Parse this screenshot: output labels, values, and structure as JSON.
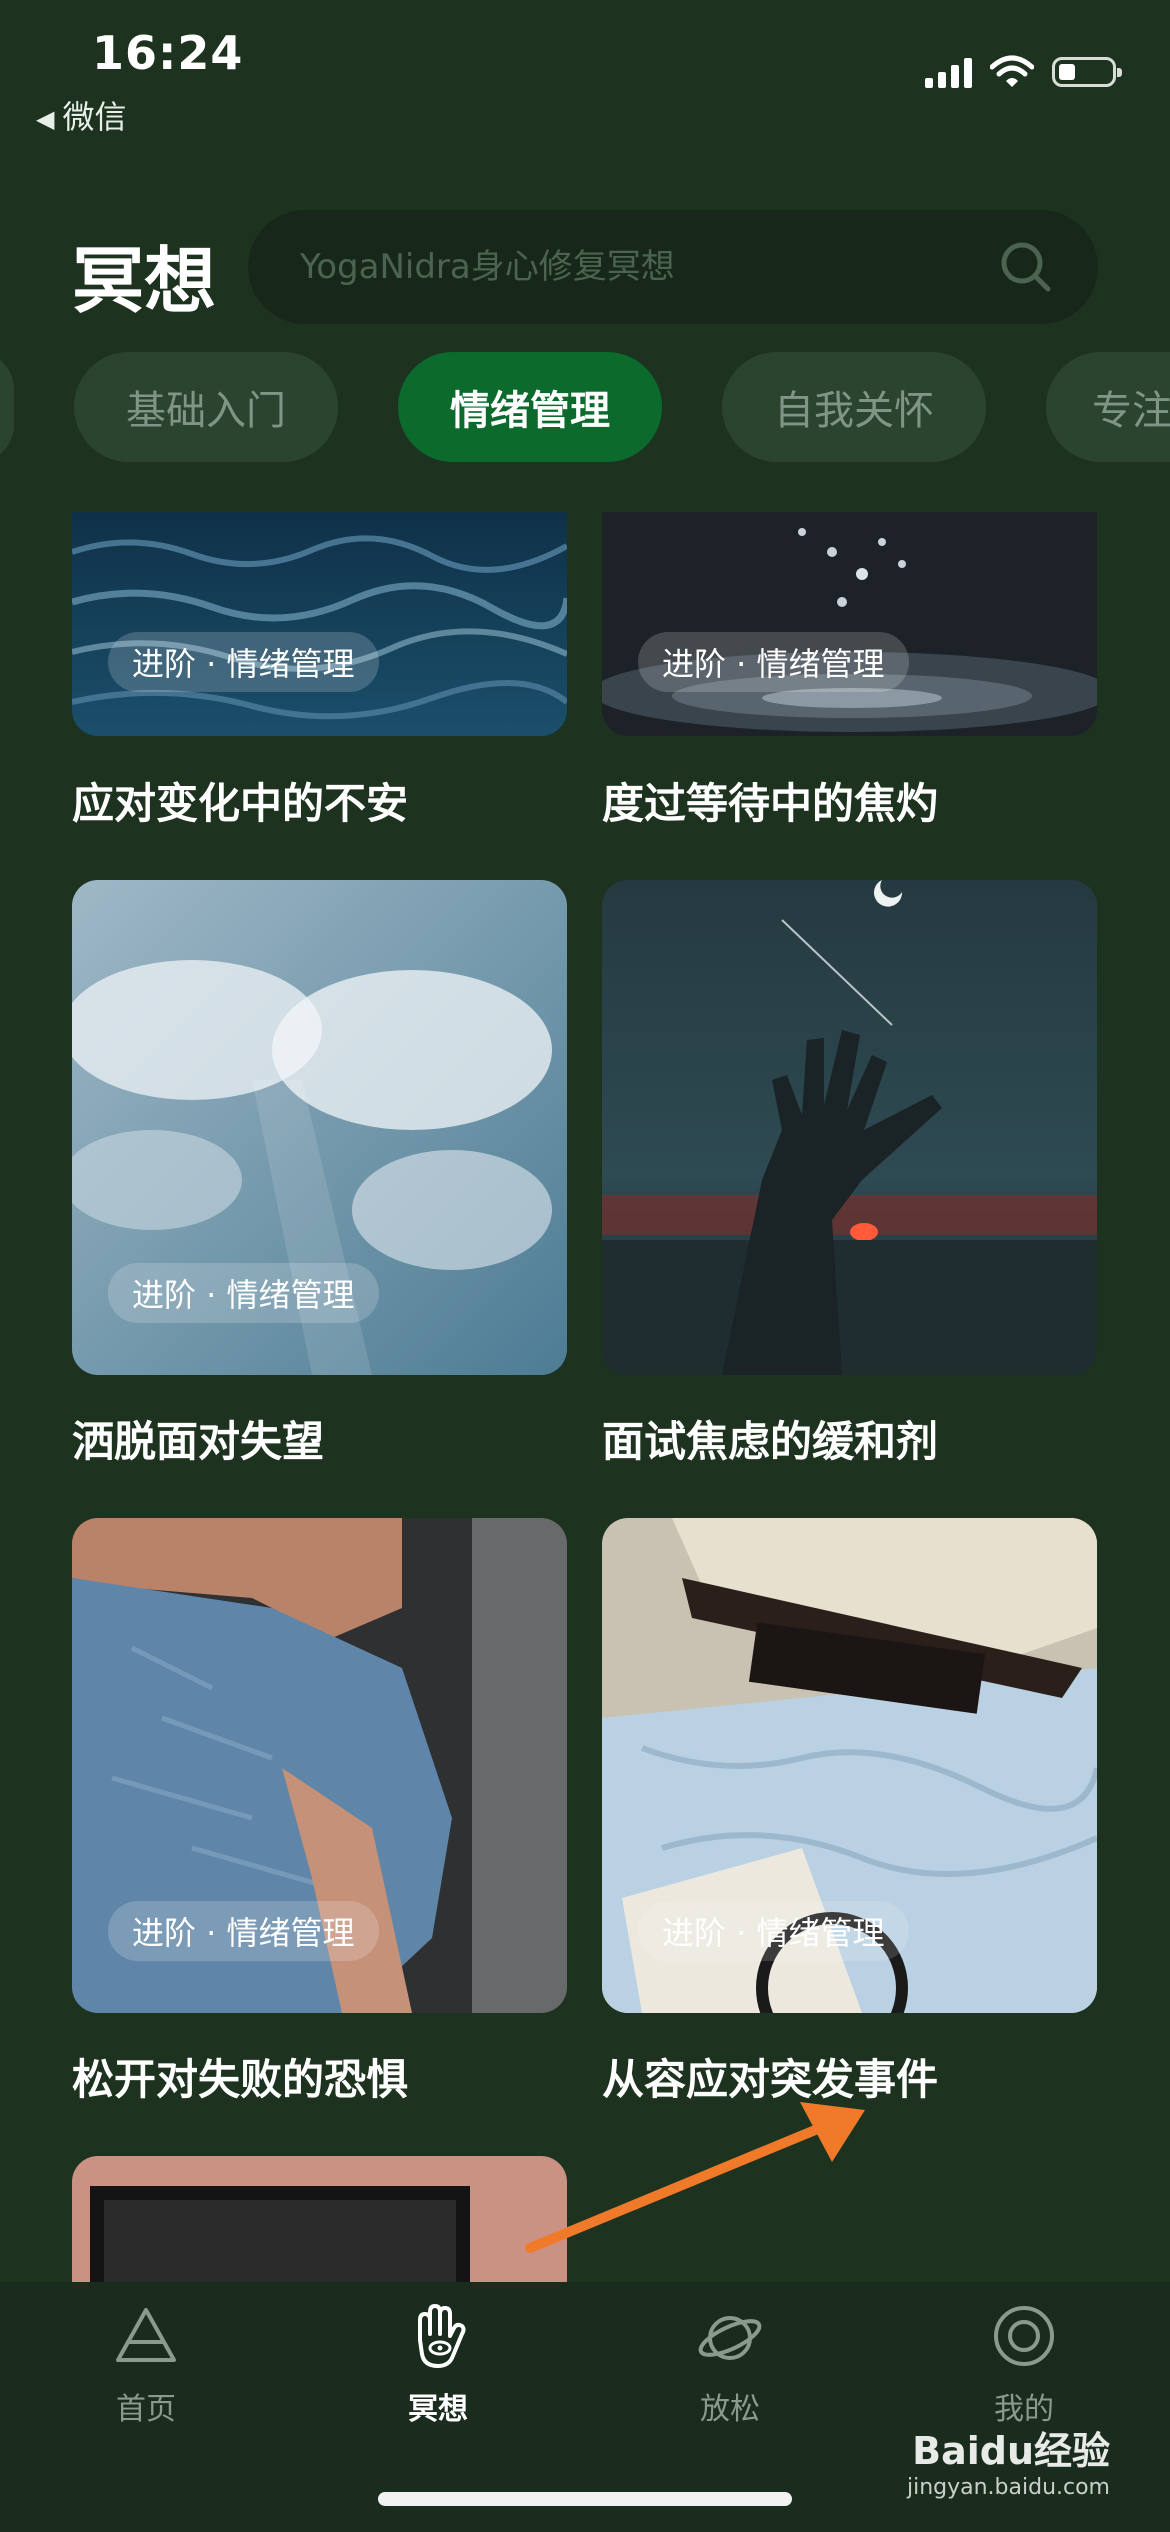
{
  "status_bar": {
    "time": "16:24",
    "back_label": "微信"
  },
  "header": {
    "title": "冥想",
    "search_placeholder": "YogaNidra身心修复冥想"
  },
  "tabs": [
    {
      "label": "基础入门",
      "active": false
    },
    {
      "label": "情绪管理",
      "active": true
    },
    {
      "label": "自我关怀",
      "active": false
    },
    {
      "label": "专注",
      "active": false
    }
  ],
  "cards": [
    {
      "badge": "进阶 · 情绪管理",
      "title": "应对变化中的不安",
      "image": "ocean-waves"
    },
    {
      "badge": "进阶 · 情绪管理",
      "title": "度过等待中的焦灼",
      "image": "water-drops"
    },
    {
      "badge": "进阶 · 情绪管理",
      "title": "洒脱面对失望",
      "image": "clouds-sky"
    },
    {
      "badge": "",
      "title": "面试焦虑的缓和剂",
      "image": "hand-silhouette-sunset"
    },
    {
      "badge": "进阶 · 情绪管理",
      "title": "松开对失败的恐惧",
      "image": "person-hugging-knees"
    },
    {
      "badge": "进阶 · 情绪管理",
      "title": "从容应对突发事件",
      "image": "ship-model-map"
    }
  ],
  "bottom_nav": [
    {
      "label": "首页",
      "icon": "triangle-icon",
      "active": false
    },
    {
      "label": "冥想",
      "icon": "hand-eye-icon",
      "active": true
    },
    {
      "label": "放松",
      "icon": "planet-icon",
      "active": false
    },
    {
      "label": "我的",
      "icon": "target-circle-icon",
      "active": false
    }
  ],
  "watermark": {
    "brand": "Baidu经验",
    "url": "jingyan.baidu.com"
  },
  "colors": {
    "background": "#1d3320",
    "active_tab": "#0b6a2c",
    "arrow": "#f07a2a"
  }
}
